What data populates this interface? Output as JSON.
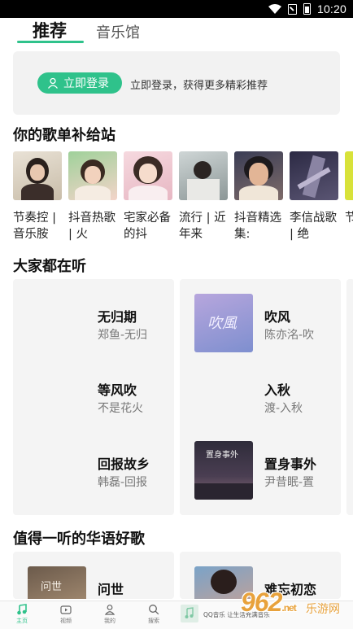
{
  "status_bar": {
    "time": "10:20"
  },
  "tabs": {
    "recommend": "推荐",
    "music_hall": "音乐馆"
  },
  "login": {
    "button": "立即登录",
    "hint": "立即登录，获得更多精彩推荐"
  },
  "playlist_section": {
    "title": "你的歌单补给站",
    "items": [
      {
        "title": "节奏控 | 音乐胺"
      },
      {
        "title": "抖音热歌 | 火"
      },
      {
        "title": "宅家必备的抖"
      },
      {
        "title": "流行 | 近年来"
      },
      {
        "title": "抖音精选集:"
      },
      {
        "title": "李信战歌 | 绝"
      },
      {
        "title": "节对"
      }
    ]
  },
  "listen_section": {
    "title": "大家都在听",
    "left_column": [
      {
        "title": "无归期",
        "subtitle": "郑鱼-无归"
      },
      {
        "title": "等风吹",
        "subtitle": "不是花火"
      },
      {
        "title": "回报故乡",
        "subtitle": "韩磊-回报"
      }
    ],
    "right_column": [
      {
        "title": "吹风",
        "subtitle": "陈亦洺-吹",
        "cover_text": "吹風"
      },
      {
        "title": "入秋",
        "subtitle": "渡-入秋"
      },
      {
        "title": "置身事外",
        "subtitle": "尹昔眠-置",
        "cover_text": "置身事外"
      }
    ]
  },
  "huayu_section": {
    "title": "值得一听的华语好歌",
    "left": {
      "title": "问世",
      "cover_text": "问世"
    },
    "right": {
      "title": "难忘初恋"
    }
  },
  "bottom_nav": {
    "items": [
      {
        "label": "主页"
      },
      {
        "label": "视频"
      },
      {
        "label": "我的"
      },
      {
        "label": "搜索"
      }
    ],
    "mini_player_text": "QQ音乐 让生活充满音乐"
  },
  "watermark": {
    "logo": "962",
    "suffix": ".net",
    "text": "乐游网"
  },
  "colors": {
    "accent": "#2fc28b"
  }
}
